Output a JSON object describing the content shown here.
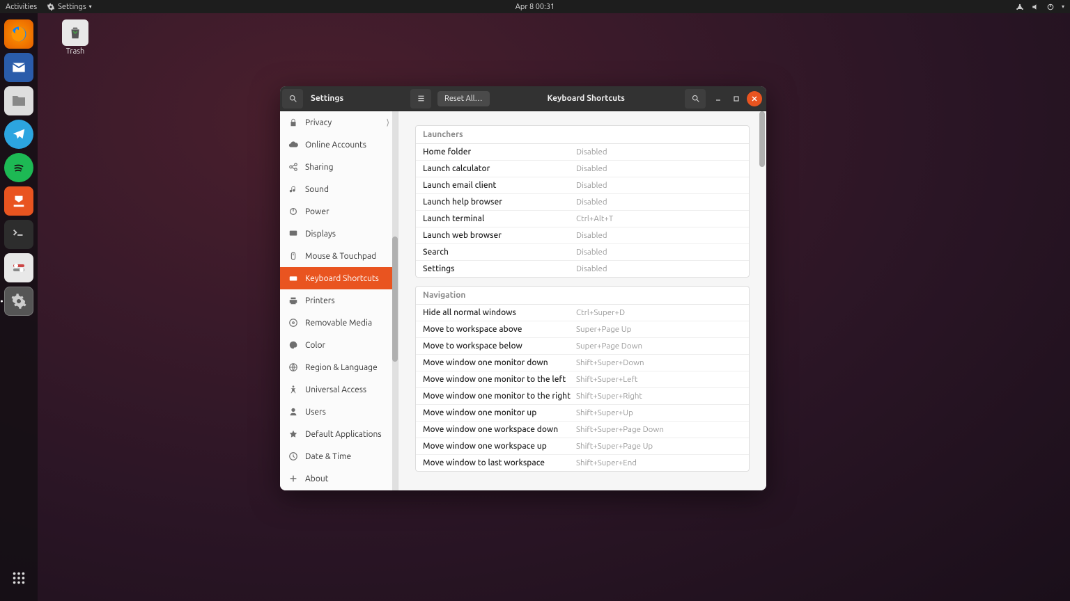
{
  "topbar": {
    "activities": "Activities",
    "app_menu": "Settings",
    "datetime": "Apr 8  00:31"
  },
  "desktop": {
    "trash_label": "Trash"
  },
  "window": {
    "app_title": "Settings",
    "page_title": "Keyboard Shortcuts",
    "reset_button": "Reset All…"
  },
  "sidebar": {
    "items": [
      {
        "id": "privacy",
        "label": "Privacy",
        "icon": "lock",
        "chevron": true
      },
      {
        "id": "online-accounts",
        "label": "Online Accounts",
        "icon": "cloud"
      },
      {
        "id": "sharing",
        "label": "Sharing",
        "icon": "share"
      },
      {
        "id": "sound",
        "label": "Sound",
        "icon": "music"
      },
      {
        "id": "power",
        "label": "Power",
        "icon": "power"
      },
      {
        "id": "displays",
        "label": "Displays",
        "icon": "display"
      },
      {
        "id": "mouse-touchpad",
        "label": "Mouse & Touchpad",
        "icon": "mouse"
      },
      {
        "id": "keyboard-shortcuts",
        "label": "Keyboard Shortcuts",
        "icon": "keyboard",
        "selected": true
      },
      {
        "id": "printers",
        "label": "Printers",
        "icon": "printer"
      },
      {
        "id": "removable-media",
        "label": "Removable Media",
        "icon": "disc"
      },
      {
        "id": "color",
        "label": "Color",
        "icon": "palette"
      },
      {
        "id": "region-language",
        "label": "Region & Language",
        "icon": "globe"
      },
      {
        "id": "universal-access",
        "label": "Universal Access",
        "icon": "accessibility"
      },
      {
        "id": "users",
        "label": "Users",
        "icon": "user"
      },
      {
        "id": "default-applications",
        "label": "Default Applications",
        "icon": "star"
      },
      {
        "id": "date-time",
        "label": "Date & Time",
        "icon": "clock"
      },
      {
        "id": "about",
        "label": "About",
        "icon": "plus"
      }
    ]
  },
  "shortcuts": {
    "sections": [
      {
        "title": "Launchers",
        "rows": [
          {
            "label": "Home folder",
            "value": "Disabled"
          },
          {
            "label": "Launch calculator",
            "value": "Disabled"
          },
          {
            "label": "Launch email client",
            "value": "Disabled"
          },
          {
            "label": "Launch help browser",
            "value": "Disabled"
          },
          {
            "label": "Launch terminal",
            "value": "Ctrl+Alt+T"
          },
          {
            "label": "Launch web browser",
            "value": "Disabled"
          },
          {
            "label": "Search",
            "value": "Disabled"
          },
          {
            "label": "Settings",
            "value": "Disabled"
          }
        ]
      },
      {
        "title": "Navigation",
        "rows": [
          {
            "label": "Hide all normal windows",
            "value": "Ctrl+Super+D"
          },
          {
            "label": "Move to workspace above",
            "value": "Super+Page Up"
          },
          {
            "label": "Move to workspace below",
            "value": "Super+Page Down"
          },
          {
            "label": "Move window one monitor down",
            "value": "Shift+Super+Down"
          },
          {
            "label": "Move window one monitor to the left",
            "value": "Shift+Super+Left"
          },
          {
            "label": "Move window one monitor to the right",
            "value": "Shift+Super+Right"
          },
          {
            "label": "Move window one monitor up",
            "value": "Shift+Super+Up"
          },
          {
            "label": "Move window one workspace down",
            "value": "Shift+Super+Page Down"
          },
          {
            "label": "Move window one workspace up",
            "value": "Shift+Super+Page Up"
          },
          {
            "label": "Move window to last workspace",
            "value": "Shift+Super+End"
          }
        ]
      }
    ]
  }
}
